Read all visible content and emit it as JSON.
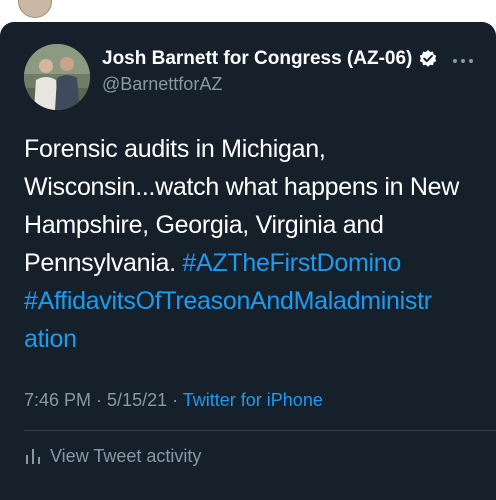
{
  "author": {
    "display_name": "Josh Barnett for Congress (AZ-06)",
    "handle": "@BarnettforAZ",
    "verified": true
  },
  "tweet": {
    "text_plain": "Forensic audits in Michigan, Wisconsin...watch what happens in New Hampshire, Georgia, Virginia and Pennsylvania.",
    "hashtag_1": "#AZTheFirstDomino",
    "hashtag_2_line1": "#AffidavitsOfTreasonAndMaladministr",
    "hashtag_2_line2": "ation"
  },
  "meta": {
    "time": "7:46 PM",
    "sep1": " · ",
    "date": "5/15/21",
    "sep2": " · ",
    "source": "Twitter for iPhone"
  },
  "actions": {
    "view_activity_label": "View Tweet activity"
  },
  "colors": {
    "background": "#15202b",
    "text": "#ffffff",
    "muted": "#8899a6",
    "link": "#1d9bf0",
    "divider": "#38444d"
  },
  "icons": {
    "verified": "verified-badge-icon",
    "more": "more-options-icon",
    "activity": "tweet-activity-icon"
  }
}
